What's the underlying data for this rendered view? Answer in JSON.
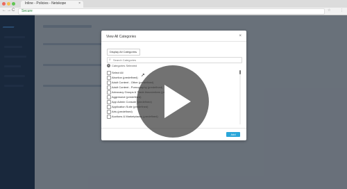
{
  "browser": {
    "tab_title": "Inline - Policies - Netskope",
    "tab_close": "×",
    "back_icon": "←",
    "forward_icon": "→",
    "reload_icon": "C",
    "secure_label": "Secure",
    "bookmark_icon": "☆",
    "menu_icon": "⋮",
    "window_dots": [
      "#ec6a5e",
      "#f4bf4f",
      "#61c554"
    ]
  },
  "modal": {
    "title": "View All Categories",
    "close_icon": "×",
    "filter_dropdown": {
      "selected": "Display All Categories",
      "caret": "⌄"
    },
    "search": {
      "icon": "⌕",
      "placeholder": "Search Categories",
      "value": ""
    },
    "selected_count": "0",
    "selected_label": "Categories Selected",
    "categories": [
      "Select All",
      "Abortion (predefined)",
      "Adult Content - Other (predefined)",
      "Adult Content - Pornography (predefined)",
      "Advocacy Groups & Trade Associations (predefined)",
      "Aggressive (predefined)",
      "App Admin Console (predefined)",
      "Application Suite (predefined)",
      "Arts (predefined)",
      "Auctions & Marketplaces (predefined)"
    ],
    "add_button": "Add"
  },
  "overlay": {
    "play_icon": "play-icon"
  },
  "colors": {
    "sidebar": "#233754",
    "accent": "#2aa6d9",
    "secure": "#2a8a3e"
  }
}
